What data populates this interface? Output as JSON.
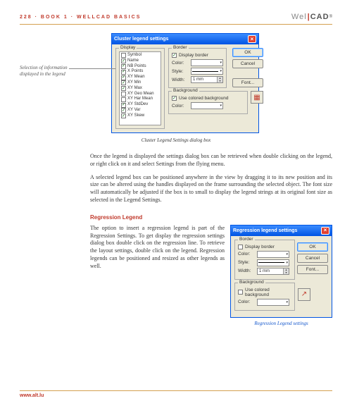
{
  "header": {
    "page_no": "228",
    "book": "BOOK 1",
    "section": "WELLCAD BASICS",
    "brand_wel": "Wel",
    "brand_cad": "CAD",
    "brand_rm": "®"
  },
  "sidenote": "Selection of information displayed in the legend",
  "dialog1": {
    "title": "Cluster legend settings",
    "display_label": "Display",
    "items": [
      {
        "checked": false,
        "label": "Symbol"
      },
      {
        "checked": true,
        "label": "Name"
      },
      {
        "checked": true,
        "label": "NB Points"
      },
      {
        "checked": true,
        "label": "X Points"
      },
      {
        "checked": true,
        "label": "XY Mean"
      },
      {
        "checked": true,
        "label": "XY Min"
      },
      {
        "checked": true,
        "label": "XY Max"
      },
      {
        "checked": false,
        "label": "XY Geo Mean"
      },
      {
        "checked": false,
        "label": "XY Har Mean"
      },
      {
        "checked": true,
        "label": "XY StdDev"
      },
      {
        "checked": true,
        "label": "XY Var"
      },
      {
        "checked": true,
        "label": "XY Skew"
      }
    ],
    "border_label": "Border",
    "display_border": "Display border",
    "color_label": "Color:",
    "style_label": "Style:",
    "width_label": "Width:",
    "width_value": "1 mm",
    "background_label": "Background",
    "use_colored_bg": "Use colored background",
    "bg_color_label": "Color:",
    "btn_ok": "OK",
    "btn_cancel": "Cancel",
    "btn_font": "Font..."
  },
  "caption1": "Cluster Legend Settings dialog box",
  "para1": "Once the legend is displayed the settings dialog box can be retrieved when double clicking on the legend, or right click on it and select Settings from the flying menu.",
  "para2": "A selected legend box can be positioned anywhere in the view by dragging it to its new position and its size can be altered using the handles displayed on the frame surrounding the selected object. The font size will automatically be adjusted if the box is to small to display the legend strings at its original font size as selected in the Legend Settings.",
  "section2_head": "Regression Legend",
  "para3": "The option to insert a regression legend is part of the Regression Settings. To get display the regression settings dialog box double click on the regression line. To retrieve the layout settings, double click on the legend. Regression legends can be positioned and resized as other legends as well.",
  "dialog2": {
    "title": "Regression legend settings",
    "border_label": "Border",
    "display_border": "Display border",
    "color_label": "Color:",
    "style_label": "Style:",
    "width_label": "Width:",
    "width_value": "1 mm",
    "background_label": "Background",
    "use_colored_bg": "Use colored background",
    "bg_color_label": "Color:",
    "btn_ok": "OK",
    "btn_cancel": "Cancel",
    "btn_font": "Font..."
  },
  "caption2": "Regression Legend settings",
  "footer_url": "www.alt.lu"
}
